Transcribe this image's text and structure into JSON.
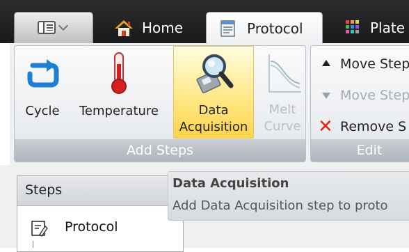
{
  "tabs": {
    "home": {
      "label": "Home",
      "icon": "home-icon"
    },
    "protocol": {
      "label": "Protocol",
      "icon": "protocol-document-icon",
      "active": true
    },
    "plate": {
      "label": "Plate",
      "icon": "plate-grid-icon"
    }
  },
  "ribbon": {
    "add_steps": {
      "caption": "Add Steps",
      "buttons": [
        {
          "line1": "Cycle",
          "icon": "cycle-icon"
        },
        {
          "line1": "Temperature",
          "icon": "thermometer-icon"
        },
        {
          "line1": "Data",
          "line2": "Acquisition",
          "icon": "data-acquisition-icon",
          "highlighted": true
        },
        {
          "line1": "Melt",
          "line2": "Curve",
          "icon": "melt-curve-icon",
          "enabled": false
        }
      ]
    },
    "edit": {
      "caption": "Edit",
      "move_up_label": "Move Step",
      "move_down_label": "Move Step",
      "remove_label": "Remove S"
    }
  },
  "steps_panel": {
    "header": "Steps",
    "items": [
      {
        "label": "Protocol",
        "icon": "protocol-step-icon"
      }
    ]
  },
  "tooltip": {
    "title": "Data Acquisition",
    "body": "Add Data Acquisition step to proto"
  },
  "colors": {
    "highlight": "#ffd34c",
    "remove_x": "#e0261a",
    "cycle_blue": "#1f7fd1",
    "tabstrip": "#1a1a1a"
  }
}
